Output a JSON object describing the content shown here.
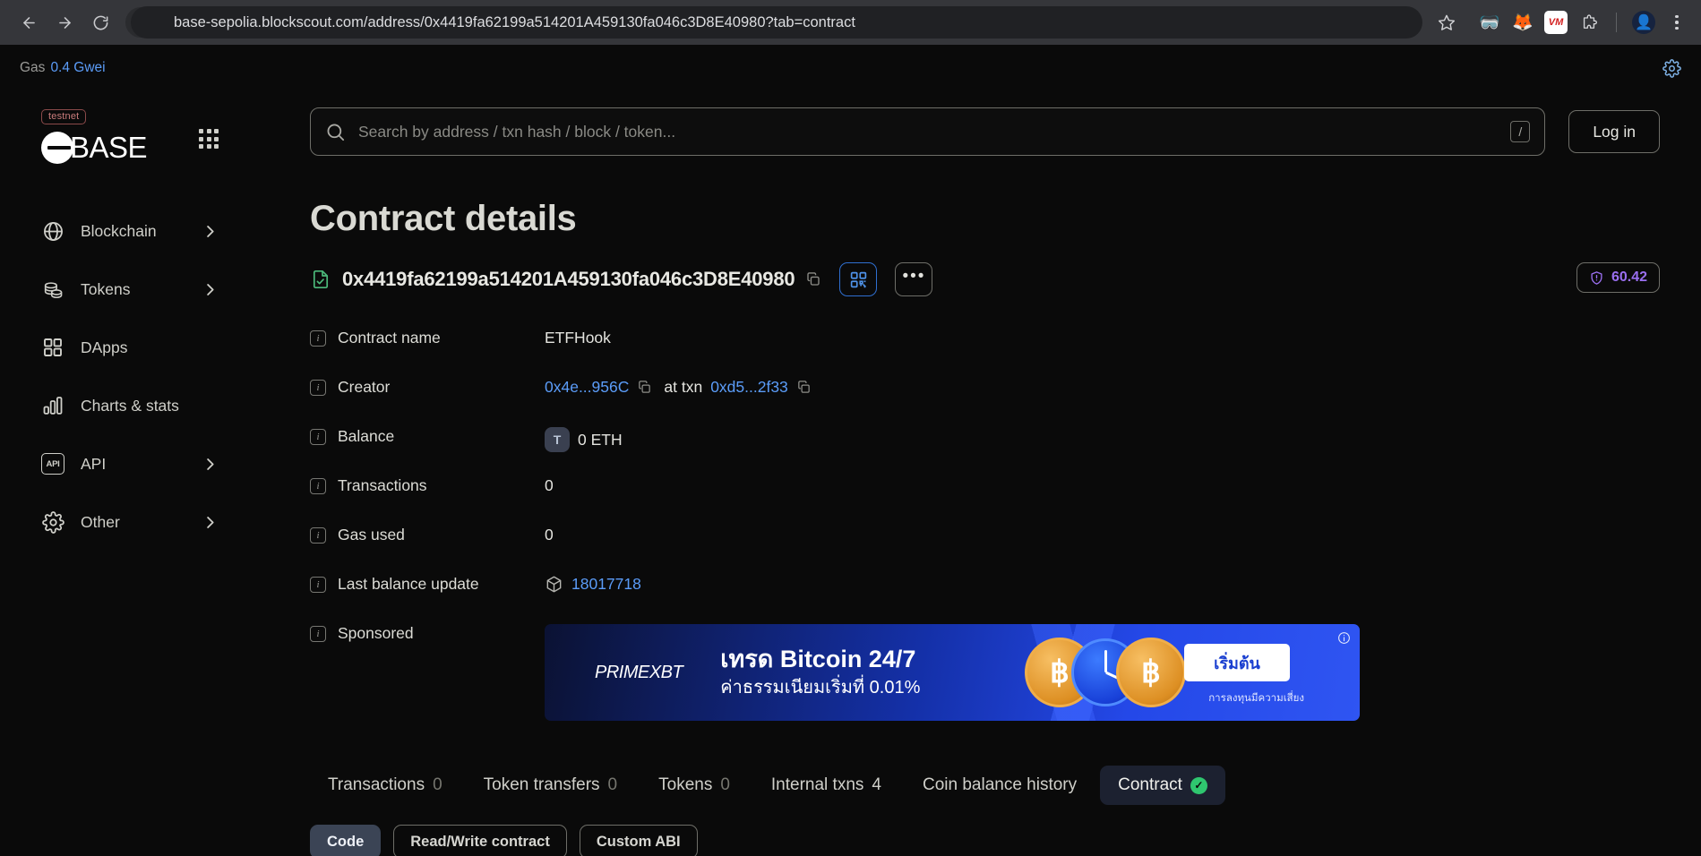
{
  "browser": {
    "url": "base-sepolia.blockscout.com/address/0x4419fa62199a514201A459130fa046c3D8E40980?tab=contract",
    "back_icon": "back-arrow-icon",
    "forward_icon": "forward-arrow-icon",
    "reload_icon": "reload-icon",
    "site_info_icon": "site-settings-icon",
    "bookmark_icon": "star-icon",
    "extensions": [
      {
        "name": "goggles-extension-icon",
        "glyph": "🥽",
        "bg": "transparent"
      },
      {
        "name": "metamask-extension-icon",
        "glyph": "🦊",
        "bg": "transparent"
      },
      {
        "name": "vm-extension-icon",
        "glyph": "VM",
        "bg": "#ffffff",
        "fg": "#d32020"
      },
      {
        "name": "extensions-puzzle-icon",
        "glyph": "⬜",
        "bg": "transparent"
      },
      {
        "name": "profile-avatar-icon",
        "glyph": "👤",
        "bg": "#1b2a4a"
      }
    ],
    "menu_icon": "kebab-menu-icon"
  },
  "topbar": {
    "gas_label": "Gas",
    "gas_value": "0.4 Gwei",
    "settings_icon": "gear-icon"
  },
  "sidebar": {
    "network_badge": "testnet",
    "brand": "BASE",
    "brand_mark": "base-logo-icon",
    "apps_icon": "apps-grid-icon",
    "items": [
      {
        "label": "Blockchain",
        "icon": "globe-icon",
        "chevron": true
      },
      {
        "label": "Tokens",
        "icon": "coins-icon",
        "chevron": true
      },
      {
        "label": "DApps",
        "icon": "grid-icon",
        "chevron": false
      },
      {
        "label": "Charts & stats",
        "icon": "bar-chart-icon",
        "chevron": false
      },
      {
        "label": "API",
        "icon": "api-icon",
        "chevron": true
      },
      {
        "label": "Other",
        "icon": "gear-icon",
        "chevron": true
      }
    ]
  },
  "search": {
    "placeholder": "Search by address / txn hash / block / token...",
    "value": "",
    "shortcut": "/",
    "icon": "search-icon"
  },
  "header": {
    "login_label": "Log in",
    "title": "Contract details"
  },
  "address": {
    "value": "0x4419fa62199a514201A459130fa046c3D8E40980",
    "verified_icon": "verified-contract-icon",
    "copy_icon": "copy-icon",
    "qr_icon": "qr-code-icon",
    "more_icon": "more-options-icon",
    "more_label": "•••",
    "score": "60.42",
    "score_icon": "shield-alert-icon",
    "score_color": "#9a6ff0"
  },
  "details": [
    {
      "label": "Contract name",
      "value": "ETFHook"
    },
    {
      "label": "Creator",
      "creator": "0x4e...956C",
      "at_txn_label": "at txn",
      "txn": "0xd5...2f33"
    },
    {
      "label": "Balance",
      "token_badge": "T",
      "value": "0 ETH"
    },
    {
      "label": "Transactions",
      "value": "0"
    },
    {
      "label": "Gas used",
      "value": "0"
    },
    {
      "label": "Last balance update",
      "block_icon": "cube-icon",
      "value": "18017718"
    },
    {
      "label": "Sponsored",
      "value": ""
    }
  ],
  "ad": {
    "brand_prime": "PRIME",
    "brand_xbt": "XBT",
    "headline": "เทรด Bitcoin 24/7",
    "subline": "ค่าธรรมเนียมเริ่มที่ 0.01%",
    "cta": "เริ่มต้น",
    "disclaimer": "การลงทุนมีความเสี่ยง",
    "coin_symbol": "฿",
    "info_icon": "ad-info-icon"
  },
  "tabs": [
    {
      "label": "Transactions",
      "count": "0",
      "active": false
    },
    {
      "label": "Token transfers",
      "count": "0",
      "active": false
    },
    {
      "label": "Tokens",
      "count": "0",
      "active": false
    },
    {
      "label": "Internal txns",
      "count": "4",
      "active": false
    },
    {
      "label": "Coin balance history",
      "count": "",
      "active": false
    },
    {
      "label": "Contract",
      "count": "",
      "active": true,
      "check": "✓"
    }
  ],
  "subtabs": [
    {
      "label": "Code",
      "active": true
    },
    {
      "label": "Read/Write contract",
      "active": false
    },
    {
      "label": "Custom ABI",
      "active": false
    }
  ]
}
